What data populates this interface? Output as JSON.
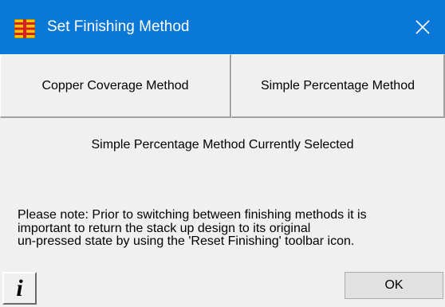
{
  "window": {
    "title": "Set Finishing Method",
    "title_icon": "stackup-layers-icon",
    "close_icon": "close-icon"
  },
  "methods": {
    "copper_label": "Copper Coverage Method",
    "simple_label": "Simple Percentage Method"
  },
  "status": {
    "text": "Simple Percentage Method Currently Selected"
  },
  "note": {
    "lines": [
      "Please note: Prior to switching between finishing methods it is",
      "important to return the stack up design to its original",
      "un-pressed state by using the 'Reset Finishing' toolbar icon."
    ]
  },
  "footer": {
    "info_glyph": "i",
    "ok_label": "OK"
  },
  "colors": {
    "titlebar": "#0a78d7",
    "dialog_bg": "#f0f0f0",
    "icon_yellow": "#f5c400",
    "icon_red": "#d42020"
  }
}
